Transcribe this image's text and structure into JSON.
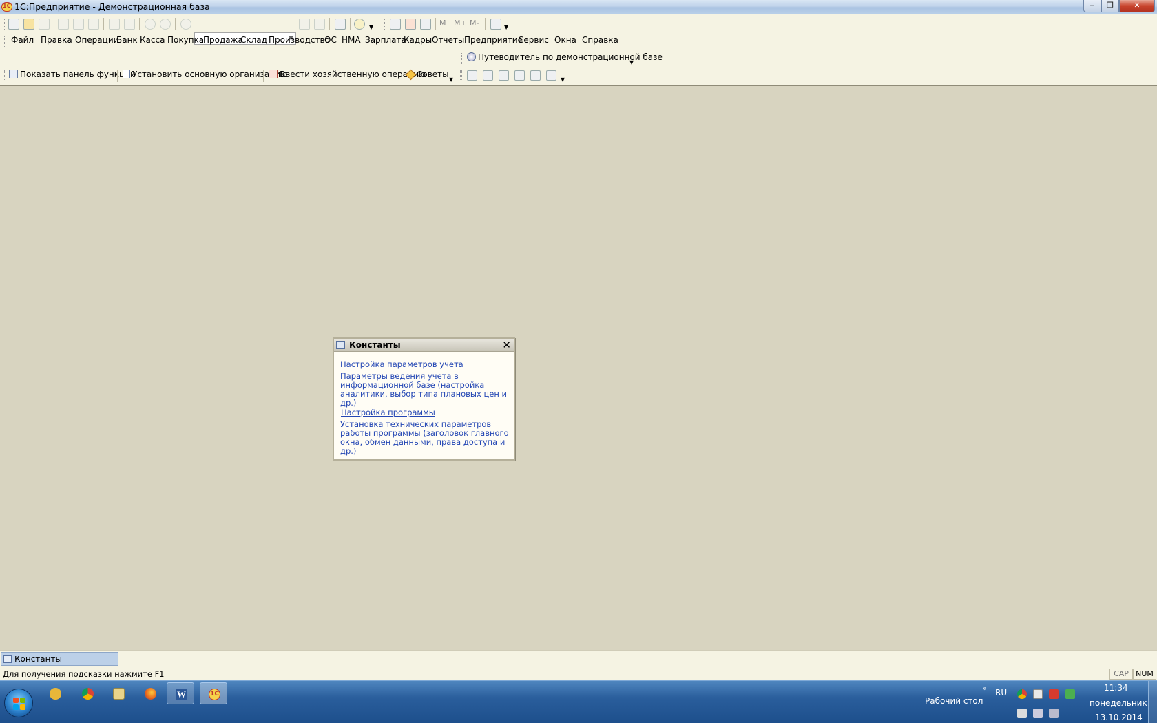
{
  "window": {
    "title": "1С:Предприятие - Демонстрационная база",
    "minimize_glyph": "‒",
    "maximize_glyph": "❐",
    "close_glyph": "✕"
  },
  "toolbar_std": {
    "memory": [
      "M",
      "M+",
      "M-"
    ]
  },
  "menu": [
    "Файл",
    "Правка",
    "Операции",
    "Банк",
    "Касса",
    "Покупка",
    "Продажа",
    "Склад",
    "Производство",
    "ОС",
    "НМА",
    "Зарплата",
    "Кадры",
    "Отчеты",
    "Предприятие",
    "Сервис",
    "Окна",
    "Справка"
  ],
  "guide": {
    "label": "Путеводитель по демонстрационной базе"
  },
  "functions_toolbar": {
    "show_panel": "Показать панель функций",
    "set_org": "Установить основную организацию",
    "enter_op": "Ввести хозяйственную операцию",
    "tips": "Советы"
  },
  "constants_window": {
    "title": "Константы",
    "close": "✕",
    "link1": "Настройка параметров учета",
    "desc1": "Параметры ведения учета в информационной базе (настройка аналитики, выбор типа плановых цен и др.)",
    "link2": "Настройка программы",
    "desc2": "Установка технических параметров работы программы (заголовок главного окна, обмен данными, права доступа и др.)"
  },
  "window_tabs": [
    {
      "label": "Константы"
    }
  ],
  "status": {
    "hint": "Для получения подсказки нажмите F1",
    "cap": "CAP",
    "num": "NUM"
  },
  "taskbar": {
    "desktop_label": "Рабочий стол",
    "chevron": "»",
    "language": "RU",
    "time": "11:34",
    "day": "понедельник",
    "date": "13.10.2014",
    "word_letter": "W",
    "onec_label": "1С"
  },
  "colors": {
    "workspace": "#d8d4c0",
    "toolbar_bg": "#f5f3e3",
    "link": "#2346b4",
    "taskbar": "#2a5e9c"
  }
}
